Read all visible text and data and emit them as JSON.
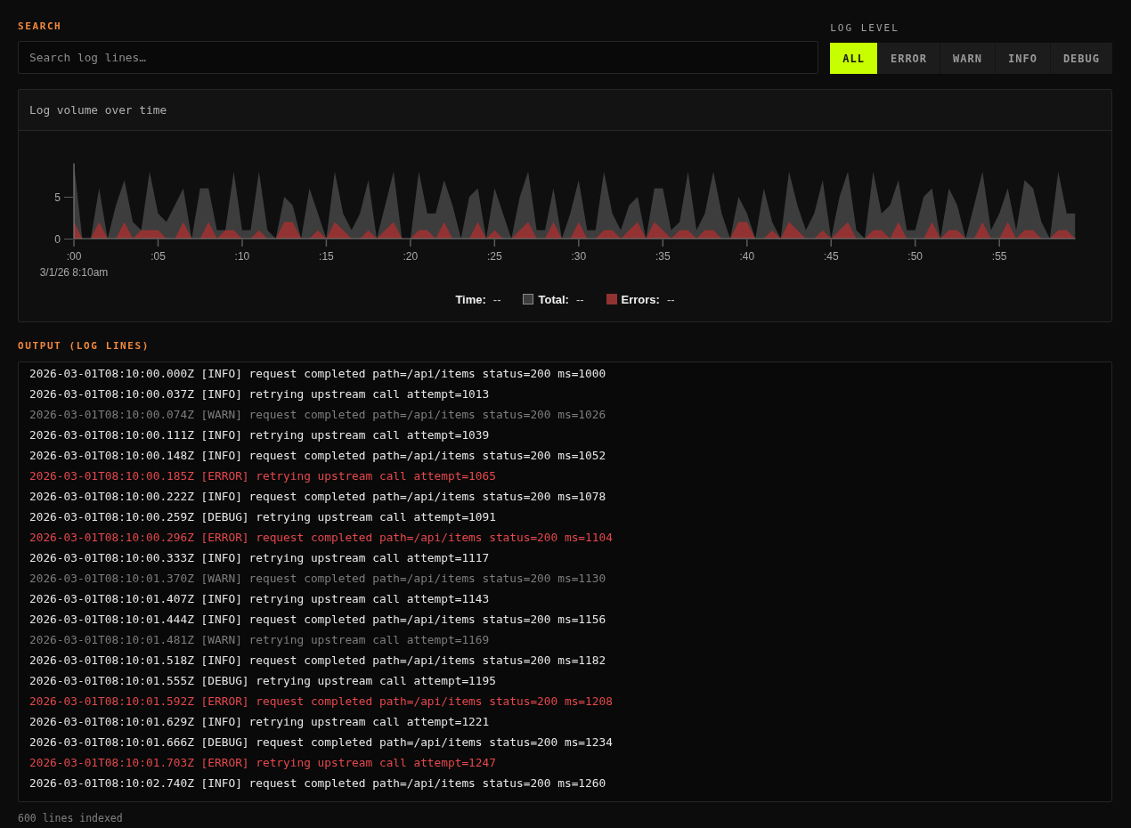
{
  "search": {
    "label": "SEARCH",
    "placeholder": "Search log lines…"
  },
  "log_level": {
    "label": "LOG LEVEL",
    "options": [
      {
        "label": "ALL",
        "selected": true
      },
      {
        "label": "ERROR",
        "selected": false
      },
      {
        "label": "WARN",
        "selected": false
      },
      {
        "label": "INFO",
        "selected": false
      },
      {
        "label": "DEBUG",
        "selected": false
      }
    ]
  },
  "volume_panel": {
    "chart_data": {
      "type": "area",
      "title": "Log volume over time",
      "xlabel": "3/1/26 8:10am",
      "x": [
        0,
        0.5,
        1,
        1.5,
        2,
        2.5,
        3,
        3.5,
        4,
        4.5,
        5,
        5.5,
        6,
        6.5,
        7,
        7.5,
        8,
        8.5,
        9,
        9.5,
        10,
        10.5,
        11,
        11.5,
        12,
        12.5,
        13,
        13.5,
        14,
        14.5,
        15,
        15.5,
        16,
        16.5,
        17,
        17.5,
        18,
        18.5,
        19,
        19.5,
        20,
        20.5,
        21,
        21.5,
        22,
        22.5,
        23,
        23.5,
        24,
        24.5,
        25,
        25.5,
        26,
        26.5,
        27,
        27.5,
        28,
        28.5,
        29,
        29.5,
        30,
        30.5,
        31,
        31.5,
        32,
        32.5,
        33,
        33.5,
        34,
        34.5,
        35,
        35.5,
        36,
        36.5,
        37,
        37.5,
        38,
        38.5,
        39,
        39.5,
        40,
        40.5,
        41,
        41.5,
        42,
        42.5,
        43,
        43.5,
        44,
        44.5,
        45,
        45.5,
        46,
        46.5,
        47,
        47.5,
        48,
        48.5,
        49,
        49.5,
        50,
        50.5,
        51,
        51.5,
        52,
        52.5,
        53,
        53.5,
        54,
        54.5,
        55,
        55.5,
        56,
        56.5,
        57,
        57.5,
        58,
        58.5,
        59,
        59.5
      ],
      "series": [
        {
          "color": "#3d3d3d",
          "values": [
            9,
            0,
            0,
            6,
            0,
            4,
            7,
            2,
            1,
            8,
            3,
            2,
            4,
            6,
            0,
            6,
            6,
            1,
            1,
            8,
            1,
            1,
            8,
            1,
            0,
            5,
            4,
            0,
            6,
            3,
            0,
            8,
            3,
            1,
            3,
            7,
            0,
            4,
            8,
            0,
            0,
            8,
            3,
            3,
            7,
            4,
            0,
            5,
            6,
            0,
            6,
            3,
            0,
            5,
            8,
            1,
            1,
            6,
            0,
            3,
            7,
            1,
            1,
            8,
            3,
            1,
            4,
            5,
            0,
            6,
            6,
            1,
            2,
            8,
            1,
            3,
            8,
            3,
            0,
            5,
            3,
            0,
            6,
            2,
            0,
            8,
            4,
            1,
            3,
            7,
            0,
            5,
            8,
            1,
            0,
            8,
            3,
            4,
            7,
            1,
            1,
            5,
            6,
            0,
            6,
            4,
            0,
            4,
            8,
            1,
            3,
            6,
            1,
            7,
            6,
            2,
            0,
            8,
            3,
            3
          ]
        },
        {
          "color": "#923232",
          "values": [
            2,
            0,
            0,
            2,
            0,
            0,
            2,
            0,
            1,
            1,
            1,
            0,
            0,
            2,
            0,
            0,
            2,
            0,
            1,
            1,
            0,
            0,
            1,
            0,
            0,
            2,
            2,
            0,
            0,
            1,
            0,
            2,
            1,
            0,
            0,
            1,
            0,
            1,
            2,
            0,
            0,
            1,
            1,
            0,
            2,
            0,
            0,
            0,
            2,
            0,
            1,
            0,
            0,
            1,
            2,
            0,
            0,
            2,
            0,
            0,
            2,
            0,
            0,
            1,
            1,
            0,
            1,
            2,
            0,
            2,
            1,
            0,
            1,
            1,
            0,
            1,
            1,
            0,
            0,
            2,
            2,
            0,
            0,
            1,
            0,
            2,
            1,
            0,
            0,
            1,
            0,
            1,
            2,
            0,
            0,
            1,
            1,
            0,
            2,
            0,
            0,
            0,
            2,
            0,
            1,
            1,
            0,
            0,
            2,
            0,
            0,
            2,
            0,
            1,
            1,
            0,
            0,
            1,
            1,
            0
          ]
        }
      ],
      "xlim": [
        0,
        59.5
      ],
      "ylim": [
        0,
        9
      ],
      "xticks": [
        {
          "value": 0,
          "label": ":00"
        },
        {
          "value": 5,
          "label": ":05"
        },
        {
          "value": 10,
          "label": ":10"
        },
        {
          "value": 15,
          "label": ":15"
        },
        {
          "value": 20,
          "label": ":20"
        },
        {
          "value": 25,
          "label": ":25"
        },
        {
          "value": 30,
          "label": ":30"
        },
        {
          "value": 35,
          "label": ":35"
        },
        {
          "value": 40,
          "label": ":40"
        },
        {
          "value": 45,
          "label": ":45"
        },
        {
          "value": 50,
          "label": ":50"
        },
        {
          "value": 55,
          "label": ":55"
        }
      ],
      "yticks": [
        0,
        5
      ]
    },
    "legend": [
      {
        "kind": "time",
        "label": "Time:",
        "value": "--"
      },
      {
        "kind": "series",
        "label": "Total:",
        "value": "--",
        "color": "#3d3d3d"
      },
      {
        "kind": "series",
        "label": "Errors:",
        "value": "--",
        "color": "#923232"
      }
    ]
  },
  "output": {
    "label": "OUTPUT (LOG LINES)",
    "lines": [
      {
        "kind": "info",
        "text": "2026-03-01T08:10:00.000Z [INFO] request completed path=/api/items status=200 ms=1000"
      },
      {
        "kind": "info",
        "text": "2026-03-01T08:10:00.037Z [INFO] retrying upstream call attempt=1013"
      },
      {
        "kind": "warn",
        "text": "2026-03-01T08:10:00.074Z [WARN] request completed path=/api/items status=200 ms=1026"
      },
      {
        "kind": "info",
        "text": "2026-03-01T08:10:00.111Z [INFO] retrying upstream call attempt=1039"
      },
      {
        "kind": "info",
        "text": "2026-03-01T08:10:00.148Z [INFO] request completed path=/api/items status=200 ms=1052"
      },
      {
        "kind": "error",
        "text": "2026-03-01T08:10:00.185Z [ERROR] retrying upstream call attempt=1065"
      },
      {
        "kind": "info",
        "text": "2026-03-01T08:10:00.222Z [INFO] request completed path=/api/items status=200 ms=1078"
      },
      {
        "kind": "debug",
        "text": "2026-03-01T08:10:00.259Z [DEBUG] retrying upstream call attempt=1091"
      },
      {
        "kind": "error",
        "text": "2026-03-01T08:10:00.296Z [ERROR] request completed path=/api/items status=200 ms=1104"
      },
      {
        "kind": "info",
        "text": "2026-03-01T08:10:00.333Z [INFO] retrying upstream call attempt=1117"
      },
      {
        "kind": "warn",
        "text": "2026-03-01T08:10:01.370Z [WARN] request completed path=/api/items status=200 ms=1130"
      },
      {
        "kind": "info",
        "text": "2026-03-01T08:10:01.407Z [INFO] retrying upstream call attempt=1143"
      },
      {
        "kind": "info",
        "text": "2026-03-01T08:10:01.444Z [INFO] request completed path=/api/items status=200 ms=1156"
      },
      {
        "kind": "warn",
        "text": "2026-03-01T08:10:01.481Z [WARN] retrying upstream call attempt=1169"
      },
      {
        "kind": "info",
        "text": "2026-03-01T08:10:01.518Z [INFO] request completed path=/api/items status=200 ms=1182"
      },
      {
        "kind": "debug",
        "text": "2026-03-01T08:10:01.555Z [DEBUG] retrying upstream call attempt=1195"
      },
      {
        "kind": "error",
        "text": "2026-03-01T08:10:01.592Z [ERROR] request completed path=/api/items status=200 ms=1208"
      },
      {
        "kind": "info",
        "text": "2026-03-01T08:10:01.629Z [INFO] retrying upstream call attempt=1221"
      },
      {
        "kind": "debug",
        "text": "2026-03-01T08:10:01.666Z [DEBUG] request completed path=/api/items status=200 ms=1234"
      },
      {
        "kind": "error",
        "text": "2026-03-01T08:10:01.703Z [ERROR] retrying upstream call attempt=1247"
      },
      {
        "kind": "info",
        "text": "2026-03-01T08:10:02.740Z [INFO] request completed path=/api/items status=200 ms=1260"
      }
    ],
    "status": "600 lines indexed"
  }
}
